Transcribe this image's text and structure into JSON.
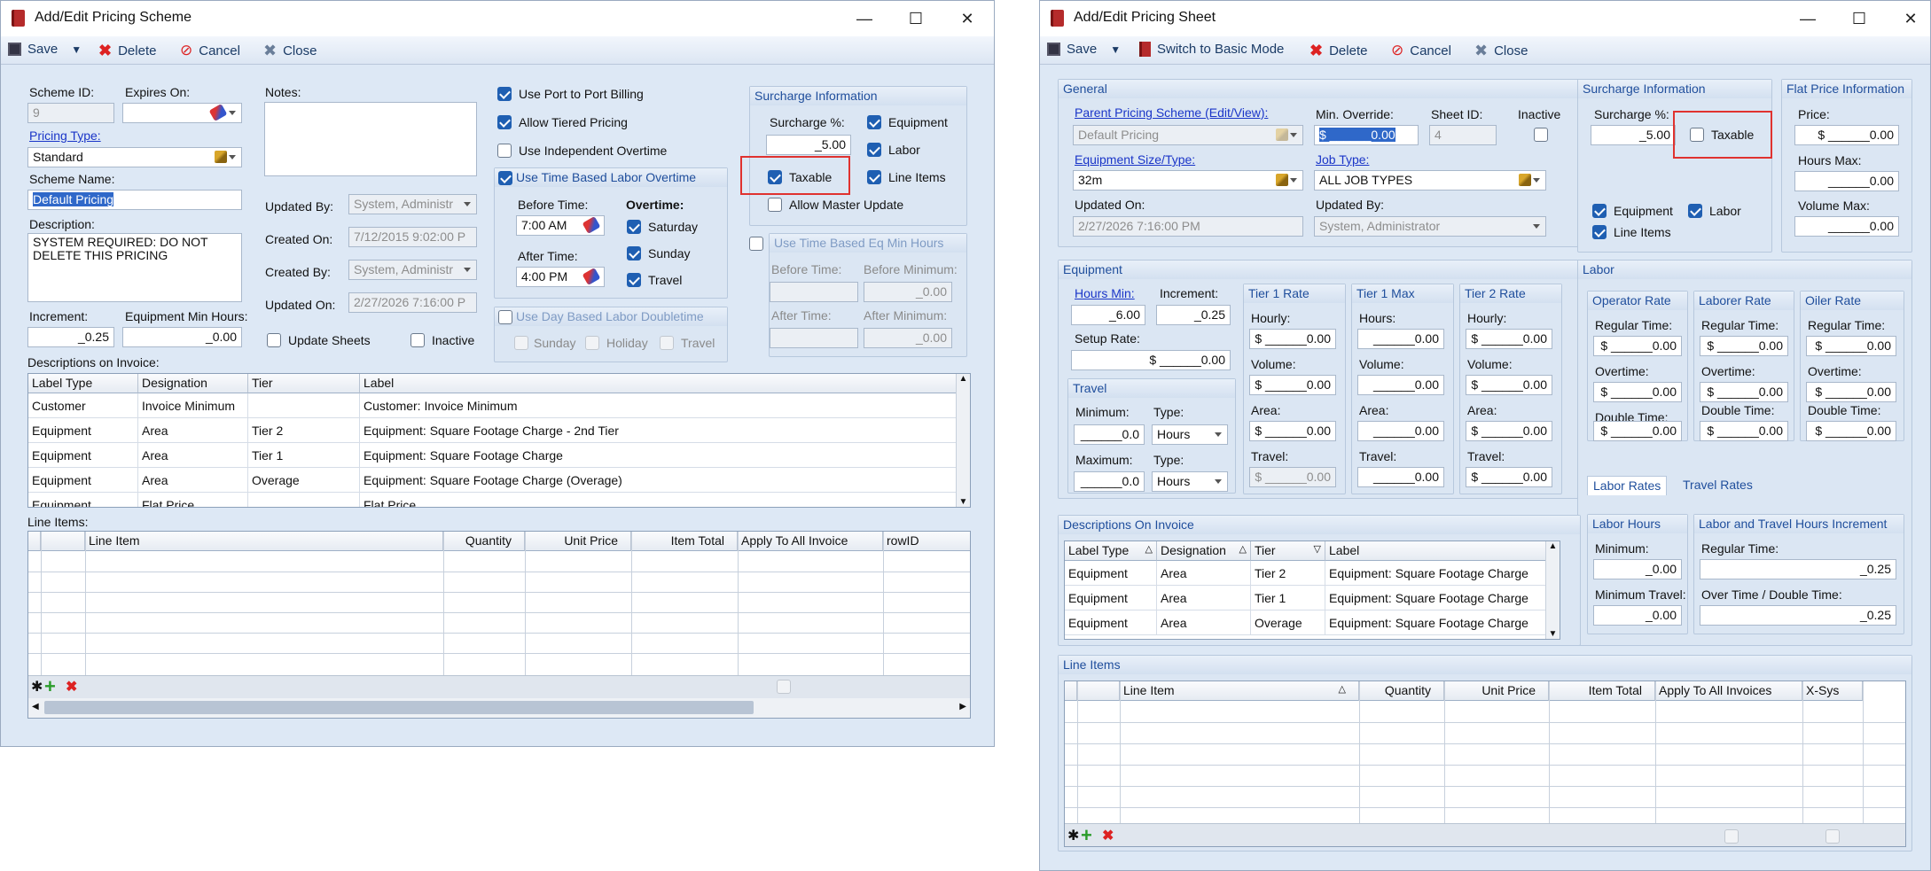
{
  "win1": {
    "title": "Add/Edit Pricing Scheme",
    "toolbar": {
      "save": "Save",
      "delete": "Delete",
      "cancel": "Cancel",
      "close": "Close"
    },
    "scheme_id_label": "Scheme ID:",
    "scheme_id": "9",
    "expires_label": "Expires On:",
    "expires": "",
    "notes_label": "Notes:",
    "notes": "",
    "pricing_type_label": "Pricing Type:",
    "pricing_type": "Standard",
    "scheme_name_label": "Scheme Name:",
    "scheme_name": "Default Pricing",
    "description_label": "Description:",
    "description": "SYSTEM REQUIRED: DO NOT DELETE THIS PRICING",
    "updated_by_label": "Updated By:",
    "updated_by": "System, Administr",
    "created_on_label": "Created On:",
    "created_on": "7/12/2015 9:02:00 P",
    "created_by_label": "Created By:",
    "created_by": "System, Administr",
    "updated_on_label": "Updated On:",
    "updated_on": "2/27/2026 7:16:00 P",
    "increment_label": "Increment:",
    "increment": "_0.25",
    "eq_min_label": "Equipment Min Hours:",
    "eq_min": "_0.00",
    "update_sheets": "Update Sheets",
    "inactive": "Inactive",
    "port_billing": "Use Port to Port Billing",
    "tiered": "Allow Tiered Pricing",
    "indep_ot": "Use Independent Overtime",
    "time_ot": {
      "title": "Use Time Based Labor Overtime",
      "before_label": "Before Time:",
      "before": "7:00 AM",
      "after_label": "After Time:",
      "after": "4:00 PM",
      "overtime_label": "Overtime:",
      "saturday": "Saturday",
      "sunday": "Sunday",
      "travel": "Travel"
    },
    "day_dt": {
      "title": "Use Day Based Labor Doubletime",
      "sunday": "Sunday",
      "holiday": "Holiday",
      "travel": "Travel"
    },
    "surcharge": {
      "title": "Surcharge Information",
      "pct_label": "Surcharge %:",
      "pct": "_5.00",
      "equipment": "Equipment",
      "labor": "Labor",
      "line_items": "Line Items",
      "taxable": "Taxable",
      "master": "Allow Master Update"
    },
    "eq_min_time": {
      "title": "Use Time Based  Eq Min Hours",
      "before_label": "Before Time:",
      "before_min_label": "Before Minimum:",
      "before_min": "_0.00",
      "after_label": "After Time:",
      "after_min_label": "After Minimum:",
      "after_min": "_0.00"
    },
    "desc_invoice_label": "Descriptions on Invoice:",
    "desc_headers": [
      "Label Type",
      "Designation",
      "Tier",
      "Label"
    ],
    "desc_rows": [
      [
        "Customer",
        "Invoice Minimum",
        "",
        "Customer: Invoice Minimum"
      ],
      [
        "Equipment",
        "Area",
        "Tier 2",
        "Equipment: Square Footage Charge - 2nd Tier"
      ],
      [
        "Equipment",
        "Area",
        "Tier 1",
        "Equipment: Square Footage Charge"
      ],
      [
        "Equipment",
        "Area",
        "Overage",
        "Equipment: Square Footage Charge (Overage)"
      ],
      [
        "Equipment",
        "Flat Price",
        "",
        "Flat Price"
      ]
    ],
    "line_items_label": "Line Items:",
    "li_headers": [
      "Line Item",
      "Quantity",
      "Unit Price",
      "Item Total",
      "Apply To All Invoice",
      "rowID"
    ]
  },
  "win2": {
    "title": "Add/Edit Pricing Sheet",
    "toolbar": {
      "save": "Save",
      "basic": "Switch to Basic Mode",
      "delete": "Delete",
      "cancel": "Cancel",
      "close": "Close"
    },
    "general": {
      "title": "General",
      "parent_label": "Parent Pricing Scheme (Edit/View):",
      "parent": "Default Pricing",
      "min_override_label": "Min. Override:",
      "min_override": "$ ______0.00",
      "sheet_id_label": "Sheet ID:",
      "sheet_id": "4",
      "inactive_label": "Inactive",
      "eq_size_label": "Equipment Size/Type:",
      "eq_size": "32m",
      "job_type_label": "Job Type:",
      "job_type": "ALL JOB TYPES",
      "updated_on_label": "Updated On:",
      "updated_on": "2/27/2026 7:16:00 PM",
      "updated_by_label": "Updated By:",
      "updated_by": "System, Administrator"
    },
    "surcharge": {
      "title": "Surcharge Information",
      "pct_label": "Surcharge %:",
      "pct": "_5.00",
      "taxable": "Taxable",
      "equipment": "Equipment",
      "labor": "Labor",
      "line_items": "Line Items"
    },
    "flat": {
      "title": "Flat Price Information",
      "price_label": "Price:",
      "price": "$ ______0.00",
      "hours_max_label": "Hours Max:",
      "hours_max": "______0.00",
      "volume_max_label": "Volume Max:",
      "volume_max": "______0.00"
    },
    "equipment": {
      "title": "Equipment",
      "hours_min_label": "Hours Min:",
      "hours_min": "_6.00",
      "increment_label": "Increment:",
      "increment": "_0.25",
      "setup_label": "Setup Rate:",
      "setup": "$ ______0.00",
      "t1r": {
        "title": "Tier 1 Rate",
        "hourly_label": "Hourly:",
        "hourly": "$ ______0.00",
        "volume_label": "Volume:",
        "volume": "$ ______0.00",
        "area_label": "Area:",
        "area": "$ ______0.00",
        "travel_label": "Travel:",
        "travel": "$ ______0.00"
      },
      "t1m": {
        "title": "Tier 1 Max",
        "hours_label": "Hours:",
        "hours": "______0.00",
        "volume_label": "Volume:",
        "volume": "______0.00",
        "area_label": "Area:",
        "area": "______0.00",
        "travel_label": "Travel:",
        "travel": "______0.00"
      },
      "t2r": {
        "title": "Tier 2 Rate",
        "hourly_label": "Hourly:",
        "hourly": "$ ______0.00",
        "volume_label": "Volume:",
        "volume": "$ ______0.00",
        "area_label": "Area:",
        "area": "$ ______0.00",
        "travel_label": "Travel:",
        "travel": "$ ______0.00"
      },
      "travel": {
        "title": "Travel",
        "min_label": "Minimum:",
        "min": "______0.0",
        "type_label": "Type:",
        "type": "Hours",
        "max_label": "Maximum:",
        "max": "______0.0",
        "type2": "Hours"
      }
    },
    "labor": {
      "title": "Labor",
      "operator": {
        "title": "Operator Rate",
        "regular_label": "Regular Time:",
        "regular": "$ ______0.00",
        "ot_label": "Overtime:",
        "ot": "$ ______0.00",
        "dt_label": "Double Time:",
        "dt": "$ ______0.00"
      },
      "laborer": {
        "title": "Laborer Rate",
        "regular_label": "Regular Time:",
        "regular": "$ ______0.00",
        "ot_label": "Overtime:",
        "ot": "$ ______0.00",
        "dt_label": "Double Time:",
        "dt": "$ ______0.00"
      },
      "oiler": {
        "title": "Oiler Rate",
        "regular_label": "Regular Time:",
        "regular": "$ ______0.00",
        "ot_label": "Overtime:",
        "ot": "$ ______0.00",
        "dt_label": "Double Time:",
        "dt": "$ ______0.00"
      },
      "tabs": [
        "Labor Rates",
        "Travel Rates"
      ],
      "hours": {
        "title": "Labor Hours",
        "min_label": "Minimum:",
        "min": "_0.00",
        "min_travel_label": "Minimum Travel:",
        "min_travel": "_0.00"
      },
      "inc": {
        "title": "Labor and Travel Hours Increment",
        "regular_label": "Regular Time:",
        "regular": "_0.25",
        "ot_label": "Over Time / Double Time:",
        "ot": "_0.25"
      }
    },
    "desc": {
      "title": "Descriptions On Invoice",
      "headers": [
        "Label Type",
        "Designation",
        "Tier",
        "Label"
      ],
      "rows": [
        [
          "Equipment",
          "Area",
          "Tier 2",
          "Equipment: Square Footage Charge"
        ],
        [
          "Equipment",
          "Area",
          "Tier 1",
          "Equipment: Square Footage Charge"
        ],
        [
          "Equipment",
          "Area",
          "Overage",
          "Equipment: Square Footage Charge"
        ]
      ]
    },
    "line_items": {
      "title": "Line Items",
      "headers": [
        "Line Item",
        "Quantity",
        "Unit Price",
        "Item Total",
        "Apply To All Invoices",
        "X-Sys"
      ]
    }
  }
}
